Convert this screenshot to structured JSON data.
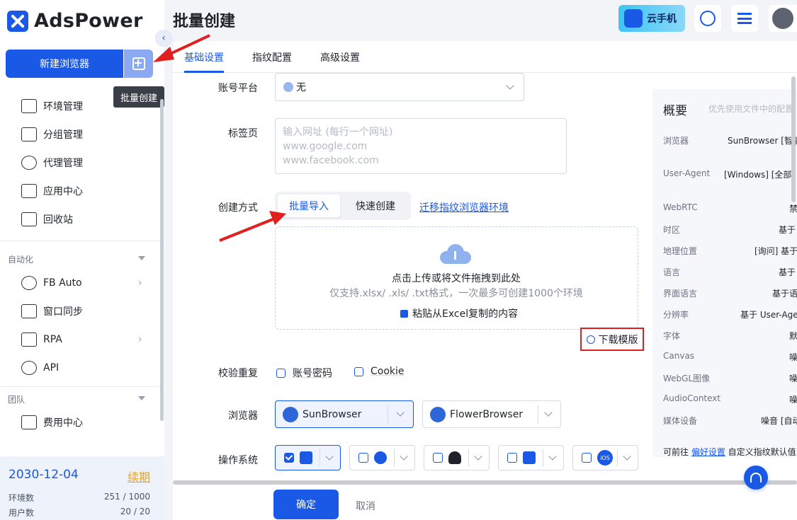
{
  "app": {
    "name": "AdsPower"
  },
  "sidebar": {
    "new_browser": "新建浏览器",
    "batch_tooltip": "批量创建",
    "items": [
      {
        "label": "环境管理",
        "icon": "browser-window-icon"
      },
      {
        "label": "分组管理",
        "icon": "folder-icon"
      },
      {
        "label": "代理管理",
        "icon": "proxy-icon"
      },
      {
        "label": "应用中心",
        "icon": "puzzle-icon"
      },
      {
        "label": "回收站",
        "icon": "trash-icon"
      }
    ],
    "automation_title": "自动化",
    "automation_items": [
      {
        "label": "FB Auto",
        "icon": "fb-auto-icon"
      },
      {
        "label": "窗口同步",
        "icon": "window-sync-icon"
      },
      {
        "label": "RPA",
        "icon": "robot-icon"
      },
      {
        "label": "API",
        "icon": "plug-icon"
      }
    ],
    "team_title": "团队",
    "team_items": [
      {
        "label": "费用中心",
        "icon": "wallet-icon"
      }
    ],
    "expiry_date": "2030-12-04",
    "renew": "续期",
    "env_label": "环境数",
    "env_value": "251 / 1000",
    "user_label": "用户数",
    "user_value": "20 / 20"
  },
  "header": {
    "title": "批量创建",
    "cloud_phone": "云手机"
  },
  "tabs": [
    "基础设置",
    "指纹配置",
    "高级设置"
  ],
  "form": {
    "account_platform_label": "账号平台",
    "account_platform_value": "无",
    "tags_label": "标签页",
    "tags_placeholder": [
      "输入网址 (每行一个网址)",
      "www.google.com",
      "www.facebook.com"
    ],
    "create_method_label": "创建方式",
    "method_batch": "批量导入",
    "method_quick": "快速创建",
    "migrate_link": "迁移指纹浏览器环境",
    "upload_main": "点击上传或将文件拖拽到此处",
    "upload_sub": "仅支持.xlsx/ .xls/ .txt格式，一次最多可创建1000个环境",
    "paste_excel": "粘贴从Excel复制的内容",
    "download_template": "下载模版",
    "dedupe_label": "校验重复",
    "dedupe_account": "账号密码",
    "dedupe_cookie": "Cookie",
    "browser_label": "浏览器",
    "browser_sun": "SunBrowser",
    "browser_flower": "FlowerBrowser",
    "os_label": "操作系统",
    "os_ios": "iOS"
  },
  "summary": {
    "title": "概要",
    "hint": "优先使用文件中的配置",
    "rows": [
      {
        "k": "浏览器",
        "v": "SunBrowser [智能匹配]"
      },
      {
        "k": "User-Agent",
        "v": "[Windows] [全部]"
      },
      {
        "k": "WebRTC",
        "v": "禁用"
      },
      {
        "k": "时区",
        "v": "基于 IP"
      },
      {
        "k": "地理位置",
        "v": "[询问] 基于 IP"
      },
      {
        "k": "语言",
        "v": "基于 IP"
      },
      {
        "k": "界面语言",
        "v": "基于语言"
      },
      {
        "k": "分辨率",
        "v": "基于 User-Agent"
      },
      {
        "k": "字体",
        "v": "默认"
      },
      {
        "k": "Canvas",
        "v": "噪音"
      },
      {
        "k": "WebGL图像",
        "v": "噪音"
      },
      {
        "k": "AudioContext",
        "v": "噪音"
      },
      {
        "k": "媒体设备",
        "v": "噪音 [自动]"
      }
    ],
    "foot_prefix": "可前往 ",
    "foot_link": "偏好设置",
    "foot_suffix": " 自定义指纹默认值"
  },
  "footer": {
    "ok": "确定",
    "cancel": "取消"
  },
  "colors": {
    "primary": "#1a58e6",
    "annotation": "#e21f1f"
  }
}
